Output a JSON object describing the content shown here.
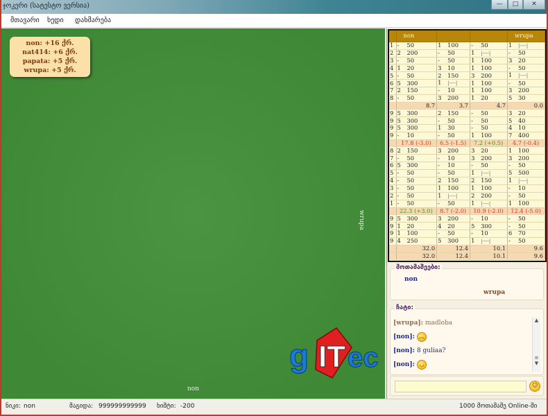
{
  "window": {
    "title": "ჯოკერი (სატესტო ვერსია)",
    "minimize": "—",
    "maximize": "□",
    "close": "✕"
  },
  "menu": [
    "მთავარი",
    "ხედი",
    "დახმარება"
  ],
  "scoreboard": [
    {
      "name": "non:",
      "value": "+16 ქრ."
    },
    {
      "name": "nat414:",
      "value": "+6 ქრ."
    },
    {
      "name": "papata:",
      "value": "+5 ქრ."
    },
    {
      "name": "wrupa:",
      "value": "+5 ქრ."
    }
  ],
  "table": {
    "seat_bottom": "non",
    "seat_right": "wrupa",
    "logo": "gITec"
  },
  "sheet": {
    "headers": [
      "non",
      "",
      "",
      "wrupa"
    ],
    "colors": {
      "green": "#3a9a1a",
      "red": "#d93a2a",
      "header": "#b8860b"
    },
    "rows": [
      {
        "n": "1",
        "c": [
          [
            "-",
            "50"
          ],
          [
            "1",
            "100"
          ],
          [
            "-",
            "50"
          ],
          [
            "1",
            "|----|"
          ]
        ]
      },
      {
        "n": "2",
        "c": [
          [
            "2",
            "200"
          ],
          [
            "-",
            "50"
          ],
          [
            "1",
            "|----|"
          ],
          [
            "-",
            "50"
          ]
        ]
      },
      {
        "n": "3",
        "c": [
          [
            "-",
            "50"
          ],
          [
            "-",
            "50"
          ],
          [
            "1",
            "100"
          ],
          [
            "3",
            "20"
          ]
        ]
      },
      {
        "n": "4",
        "c": [
          [
            "1",
            "20"
          ],
          [
            "3",
            "10"
          ],
          [
            "1",
            "100"
          ],
          [
            "-",
            "50"
          ]
        ]
      },
      {
        "n": "5",
        "c": [
          [
            "-",
            "50"
          ],
          [
            "2",
            "150"
          ],
          [
            "3",
            "200"
          ],
          [
            "1",
            "|----|"
          ]
        ]
      },
      {
        "n": "6",
        "c": [
          [
            "5",
            "300"
          ],
          [
            "1",
            "|----|"
          ],
          [
            "1",
            "100"
          ],
          [
            "-",
            "50"
          ]
        ]
      },
      {
        "n": "7",
        "c": [
          [
            "2",
            "150"
          ],
          [
            "-",
            "10"
          ],
          [
            "1",
            "100"
          ],
          [
            "3",
            "200"
          ]
        ]
      },
      {
        "n": "8",
        "c": [
          [
            "-",
            "50"
          ],
          [
            "3",
            "200"
          ],
          [
            "1",
            "20"
          ],
          [
            "5",
            "30"
          ]
        ]
      },
      {
        "sum": [
          [
            "8.7",
            ""
          ],
          [
            "3.7",
            ""
          ],
          [
            "4.7",
            ""
          ],
          [
            "0.0",
            ""
          ]
        ]
      },
      {
        "n": "9",
        "c": [
          [
            "5",
            "300"
          ],
          [
            "2",
            "150"
          ],
          [
            "-",
            "50"
          ],
          [
            "3",
            "20"
          ]
        ]
      },
      {
        "n": "9",
        "c": [
          [
            "5",
            "300"
          ],
          [
            "-",
            "50"
          ],
          [
            "-",
            "50"
          ],
          [
            "5",
            "40"
          ]
        ]
      },
      {
        "n": "9",
        "c": [
          [
            "5",
            "300"
          ],
          [
            "1",
            "30"
          ],
          [
            "-",
            "50"
          ],
          [
            "4",
            "10"
          ]
        ]
      },
      {
        "n": "9",
        "c": [
          [
            "-",
            "10"
          ],
          [
            "-",
            "50"
          ],
          [
            "1",
            "100"
          ],
          [
            "7",
            "400"
          ]
        ]
      },
      {
        "sum": [
          [
            "17.8 (-3.0)",
            "red"
          ],
          [
            "6.5 (-1.5)",
            "red"
          ],
          [
            "7.2 (+0.5)",
            "green"
          ],
          [
            "4.7 (-0.4)",
            "red"
          ]
        ]
      },
      {
        "n": "8",
        "c": [
          [
            "2",
            "150"
          ],
          [
            "3",
            "200"
          ],
          [
            "3",
            "20"
          ],
          [
            "1",
            "100"
          ]
        ]
      },
      {
        "n": "7",
        "c": [
          [
            "-",
            "50"
          ],
          [
            "-",
            "10"
          ],
          [
            "3",
            "200"
          ],
          [
            "3",
            "200"
          ]
        ]
      },
      {
        "n": "6",
        "c": [
          [
            "5",
            "300"
          ],
          [
            "-",
            "10"
          ],
          [
            "-",
            "50"
          ],
          [
            "-",
            "50"
          ]
        ]
      },
      {
        "n": "5",
        "c": [
          [
            "-",
            "50"
          ],
          [
            "-",
            "50"
          ],
          [
            "1",
            "|----|"
          ],
          [
            "5",
            "500"
          ]
        ]
      },
      {
        "n": "4",
        "c": [
          [
            "-",
            "50"
          ],
          [
            "2",
            "150"
          ],
          [
            "2",
            "150"
          ],
          [
            "1",
            "|----|"
          ]
        ]
      },
      {
        "n": "3",
        "c": [
          [
            "-",
            "50"
          ],
          [
            "1",
            "100"
          ],
          [
            "1",
            "100"
          ],
          [
            "-",
            "10"
          ]
        ]
      },
      {
        "n": "2",
        "c": [
          [
            "-",
            "50"
          ],
          [
            "1",
            "|----|"
          ],
          [
            "2",
            "200"
          ],
          [
            "-",
            "50"
          ]
        ]
      },
      {
        "n": "1",
        "c": [
          [
            "-",
            "50"
          ],
          [
            "-",
            "50"
          ],
          [
            "1",
            "|----|"
          ],
          [
            "1",
            "100"
          ]
        ]
      },
      {
        "sum": [
          [
            "22.3 (+3.0)",
            "green"
          ],
          [
            "8.7 (-2.0)",
            "red"
          ],
          [
            "10.9 (-2.0)",
            "red"
          ],
          [
            "12.4 (-5.0)",
            "red"
          ]
        ]
      },
      {
        "n": "9",
        "c": [
          [
            "5",
            "300"
          ],
          [
            "3",
            "200"
          ],
          [
            "-",
            "10"
          ],
          [
            "-",
            "50"
          ]
        ]
      },
      {
        "n": "9",
        "c": [
          [
            "1",
            "20"
          ],
          [
            "4",
            "20"
          ],
          [
            "5",
            "300"
          ],
          [
            "-",
            "50"
          ]
        ]
      },
      {
        "n": "9",
        "c": [
          [
            "1",
            "100"
          ],
          [
            "-",
            "50"
          ],
          [
            "-",
            "10"
          ],
          [
            "6",
            "70"
          ]
        ]
      },
      {
        "n": "9",
        "c": [
          [
            "4",
            "250"
          ],
          [
            "5",
            "300"
          ],
          [
            "1",
            "|----|"
          ],
          [
            "-",
            "50"
          ]
        ]
      },
      {
        "sum": [
          [
            "32.0",
            ""
          ],
          [
            "12.4",
            ""
          ],
          [
            "10.1",
            ""
          ],
          [
            "9.6",
            ""
          ]
        ]
      },
      {
        "sum": [
          [
            "32.0",
            ""
          ],
          [
            "12.4",
            ""
          ],
          [
            "10.1",
            ""
          ],
          [
            "9.6",
            ""
          ]
        ]
      }
    ]
  },
  "players": {
    "label": "მოთამაშეები:",
    "list": [
      {
        "name": "non",
        "color": "#1e2a8a"
      },
      {
        "name": "wrupa",
        "color": "#8a4a1a"
      }
    ]
  },
  "chat": {
    "label": "ჩატი:",
    "messages": [
      {
        "user": "[wrupa]:",
        "text": "madloba",
        "color": "#9a6a4a",
        "emoji": ""
      },
      {
        "user": "[non]:",
        "text": "",
        "color": "#1e2a8a",
        "emoji": "worried-face-icon"
      },
      {
        "user": "[non]:",
        "text": "8 guliaa?",
        "color": "#1e2a8a",
        "emoji": ""
      },
      {
        "user": "[non]:",
        "text": "",
        "color": "#1e2a8a",
        "emoji": "grinning-face-icon"
      }
    ],
    "input_value": ""
  },
  "status": {
    "nick_label": "ნიკი:",
    "nick": "non",
    "table_label": "მაგიდა:",
    "table": "999999999999",
    "khishti_label": "ხიშტი:",
    "khishti": "-200",
    "online": "1000 მოთამაშე Online-ში"
  }
}
